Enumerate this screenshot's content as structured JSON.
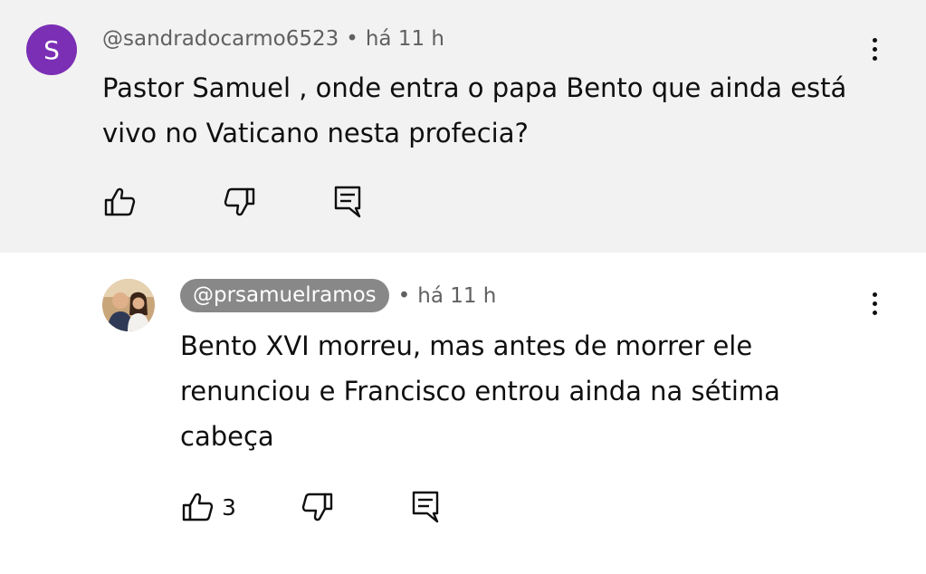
{
  "comment": {
    "avatar_letter": "S",
    "author": "@sandradocarmo6523",
    "separator": "•",
    "time": "há 11 h",
    "text_line1": "Pastor Samuel , onde entra o papa Bento que ainda está",
    "text_line2": "vivo no Vaticano nesta profecia?",
    "like_count": ""
  },
  "reply": {
    "author": "@prsamuelramos",
    "separator": "•",
    "time": "há 11 h",
    "text_line1": "Bento XVI morreu, mas antes de morrer ele",
    "text_line2": "renunciou e Francisco entrou ainda na sétima",
    "text_line3": "cabeça",
    "like_count": "3"
  },
  "colors": {
    "top_background": "#f2f2f2",
    "avatar_purple": "#7b2fb5",
    "pill_gray": "#888888",
    "meta_gray": "#606060"
  },
  "icons": [
    "thumbs-up-icon",
    "thumbs-down-icon",
    "reply-icon",
    "more-vert-icon"
  ]
}
